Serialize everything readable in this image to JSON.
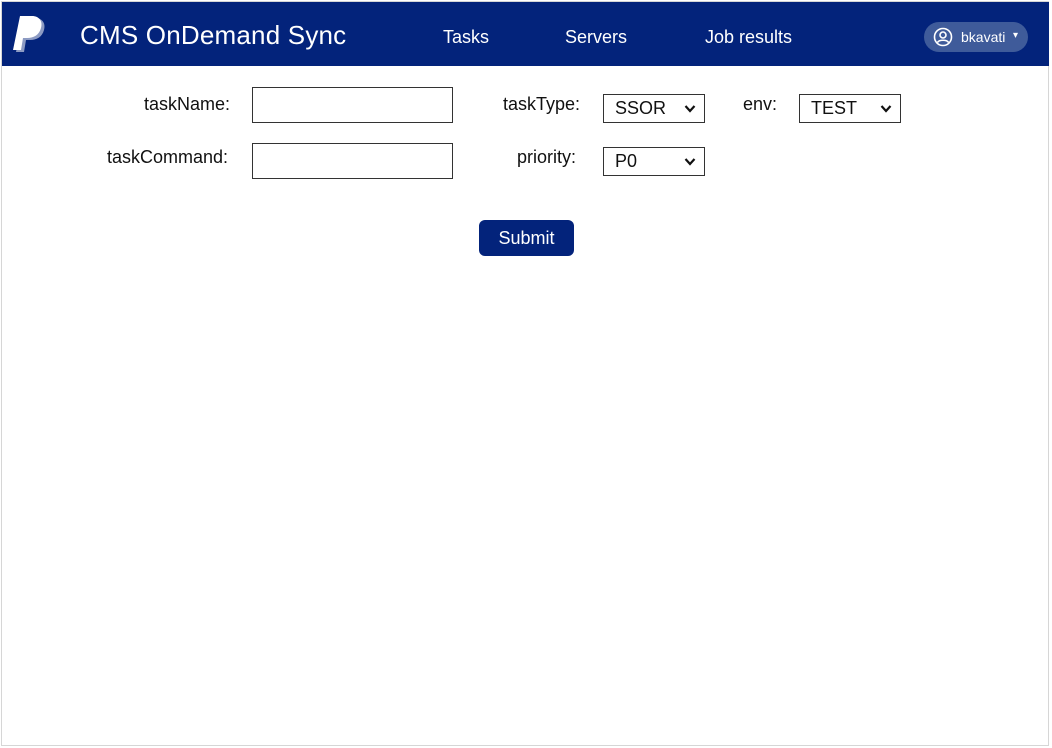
{
  "header": {
    "app_title": "CMS OnDemand Sync",
    "nav": [
      {
        "label": "Tasks"
      },
      {
        "label": "Servers"
      },
      {
        "label": "Job results"
      }
    ],
    "user": {
      "name": "bkavati",
      "caret": "▾"
    }
  },
  "form": {
    "task_name": {
      "label": "taskName:",
      "value": ""
    },
    "task_command": {
      "label": "taskCommand:",
      "value": ""
    },
    "task_type": {
      "label": "taskType:",
      "selected": "SSOR"
    },
    "priority": {
      "label": "priority:",
      "selected": "P0"
    },
    "env": {
      "label": "env:",
      "selected": "TEST"
    },
    "submit_label": "Submit"
  },
  "colors": {
    "brand": "#03237b",
    "user_pill": "#3f5b9a"
  },
  "icons": {
    "logo": "paypal-logo",
    "user": "user-circle-icon",
    "dropdown": "chevron-down-icon"
  }
}
